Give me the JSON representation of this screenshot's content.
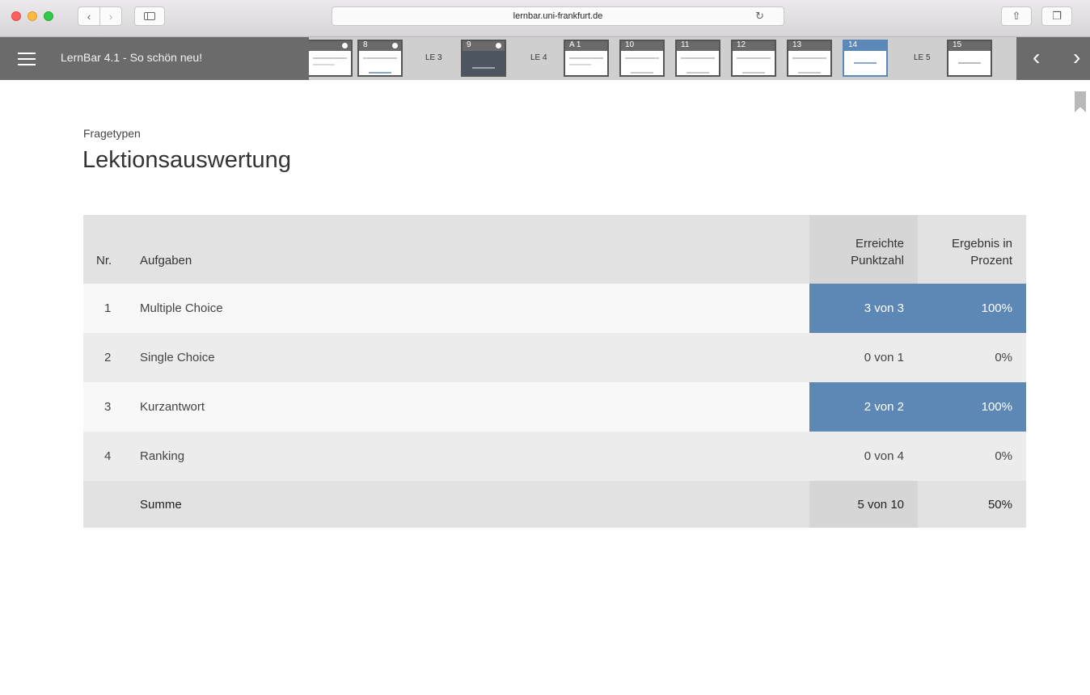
{
  "browser": {
    "url": "lernbar.uni-frankfurt.de",
    "reload_icon": "reload-icon",
    "back_icon": "chevron-left-icon",
    "forward_icon": "chevron-right-icon"
  },
  "appbar": {
    "title": "LernBar 4.1 - So schön neu!",
    "thumbnails": [
      {
        "label": "8"
      },
      {
        "label": "9"
      },
      {
        "label": "A 1"
      },
      {
        "label": "10"
      },
      {
        "label": "11"
      },
      {
        "label": "12"
      },
      {
        "label": "13"
      },
      {
        "label": "14"
      },
      {
        "label": "15"
      }
    ],
    "unit_labels": [
      "LE 3",
      "LE 4",
      "LE 5"
    ],
    "prev_arrow": "‹",
    "next_arrow": "›"
  },
  "content": {
    "subtitle": "Fragetypen",
    "title": "Lektionsauswertung"
  },
  "table": {
    "headers": {
      "nr": "Nr.",
      "aufgaben": "Aufgaben",
      "punkte_line1": "Erreichte",
      "punkte_line2": "Punktzahl",
      "prozent_line1": "Ergebnis in",
      "prozent_line2": "Prozent"
    },
    "rows": [
      {
        "nr": "1",
        "aufgabe": "Multiple Choice",
        "punkte": "3 von 3",
        "prozent": "100%",
        "success": true
      },
      {
        "nr": "2",
        "aufgabe": "Single Choice",
        "punkte": "0 von 1",
        "prozent": "0%",
        "success": false
      },
      {
        "nr": "3",
        "aufgabe": "Kurzantwort",
        "punkte": "2 von 2",
        "prozent": "100%",
        "success": true
      },
      {
        "nr": "4",
        "aufgabe": "Ranking",
        "punkte": "0 von 4",
        "prozent": "0%",
        "success": false
      }
    ],
    "summary": {
      "label": "Summe",
      "punkte": "5 von 10",
      "prozent": "50%"
    }
  },
  "colors": {
    "success": "#5d87b5",
    "appbar_dark": "#6b6b6b"
  }
}
